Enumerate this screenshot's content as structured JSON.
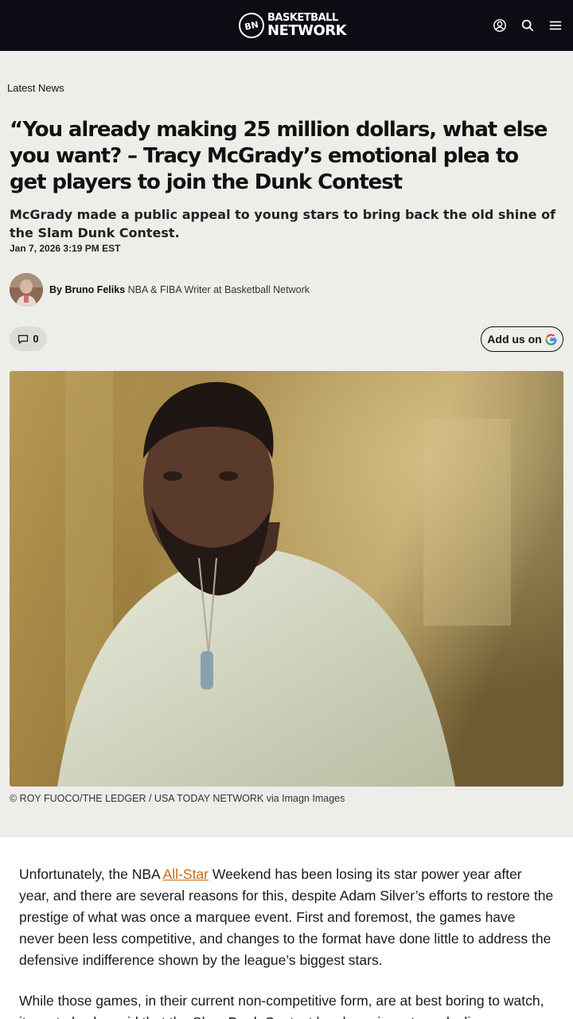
{
  "header": {
    "logo_badge": "BN",
    "logo_line1": "BASKETBALL",
    "logo_line2": "NETWORK",
    "icons": [
      "user-icon",
      "search-icon",
      "menu-icon"
    ]
  },
  "breadcrumb": "Latest News",
  "article": {
    "headline": "“You already making 25 million dollars, what else you want? – Tracy McGrady’s emotional plea to get players to join the Dunk Contest",
    "dek": "McGrady made a public appeal to young stars to bring back the old shine of the Slam Dunk Contest.",
    "date": "Jan 7, 2026 3:19 PM EST",
    "author_prefix": "By Bruno Feliks",
    "author_role": "NBA & FIBA Writer at Basketball Network",
    "comment_count": "0",
    "add_us_label": "Add us on",
    "image_caption": "© ROY FUOCO/THE LEDGER / USA TODAY NETWORK via Imagn Images",
    "paragraph1_before": "Unfortunately, the NBA ",
    "paragraph1_link": "All-Star",
    "paragraph1_after": " Weekend has been losing its star power year after year, and there are several reasons for this, despite Adam Silver’s efforts to restore the prestige of what was once a marquee event. First and foremost, the games have never been less competitive, and changes to the format have done little to address the defensive indifference shown by the league’s biggest stars.",
    "paragraph2": "While those games, in their current non-competitive form, are at best boring to watch, it must also be said that the Slam Dunk Contest has been in a steep decline"
  },
  "colors": {
    "header_bg": "#0c0c14",
    "page_bg": "#ededea",
    "link": "#c86a14"
  }
}
